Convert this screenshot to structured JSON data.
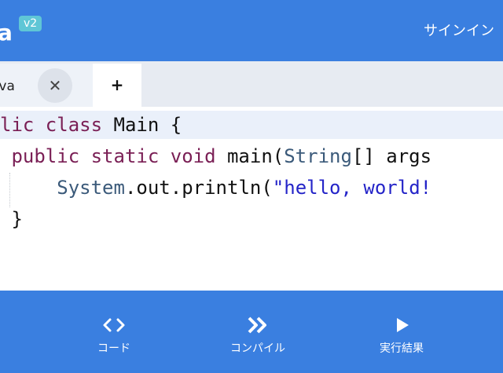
{
  "header": {
    "title": "a",
    "version": "v2",
    "signin_label": "サインイン"
  },
  "tabs": [
    {
      "label": "ava",
      "close_glyph": "✕"
    }
  ],
  "add_tab_glyph": "+",
  "editor": {
    "lines": [
      [
        {
          "t": "lic ",
          "c": "kw"
        },
        {
          "t": "class ",
          "c": "kw"
        },
        {
          "t": "Main {",
          "c": "plain"
        }
      ],
      [
        {
          "t": " public static void ",
          "c": "kw"
        },
        {
          "t": "main(",
          "c": "plain"
        },
        {
          "t": "String",
          "c": "type"
        },
        {
          "t": "[] args",
          "c": "plain"
        }
      ],
      [
        {
          "t": "     ",
          "c": "plain"
        },
        {
          "t": "System",
          "c": "type"
        },
        {
          "t": ".out.println(",
          "c": "plain"
        },
        {
          "t": "\"hello, world!",
          "c": "str"
        }
      ],
      [
        {
          "t": " }",
          "c": "plain"
        }
      ]
    ]
  },
  "bottom_nav": [
    {
      "label": "コード",
      "icon": "code-icon"
    },
    {
      "label": "コンパイル",
      "icon": "fast-forward-icon"
    },
    {
      "label": "実行結果",
      "icon": "play-icon"
    }
  ]
}
